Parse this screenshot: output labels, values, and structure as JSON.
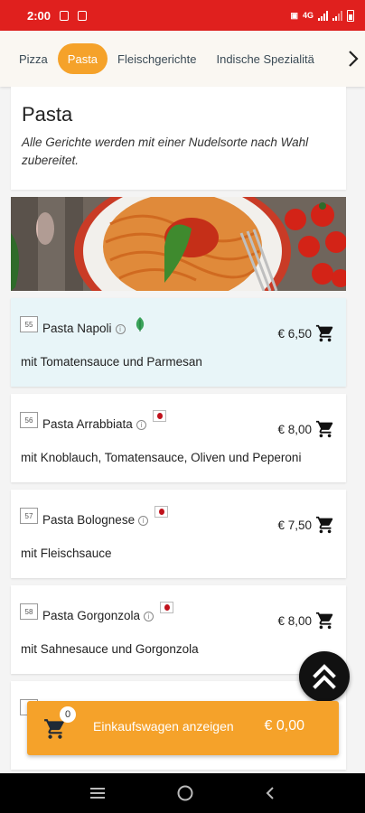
{
  "status_bar": {
    "time": "2:00",
    "network": "4G"
  },
  "tabs": [
    {
      "label": "Pizza"
    },
    {
      "label": "Pasta",
      "active": true
    },
    {
      "label": "Fleischgerichte"
    },
    {
      "label": "Indische Spezialitä"
    }
  ],
  "section": {
    "title": "Pasta",
    "description": "Alle Gerichte werden mit einer Nudelsorte nach Wahl zubereitet."
  },
  "items": [
    {
      "number": "55",
      "name": "Pasta Napoli",
      "price": "€ 6,50",
      "description": "mit Tomatensauce und Parmesan",
      "badge": "leaf-icon"
    },
    {
      "number": "56",
      "name": "Pasta Arrabbiata",
      "price": "€ 8,00",
      "description": "mit Knoblauch, Tomatensauce, Oliven und Peperoni",
      "badge": "pepper-icon"
    },
    {
      "number": "57",
      "name": "Pasta Bolognese",
      "price": "€ 7,50",
      "description": "mit Fleischsauce",
      "badge": "pepper-icon"
    },
    {
      "number": "58",
      "name": "Pasta Gorgonzola",
      "price": "€ 8,00",
      "description": "mit Sahnesauce und Gorgonzola",
      "badge": "pepper-icon"
    }
  ],
  "cart": {
    "count": "0",
    "label": "Einkaufswagen anzeigen",
    "total": "€ 0,00"
  },
  "colors": {
    "status_bar": "#e0201e",
    "accent": "#f5a22a",
    "highlight_row": "#e8f5f8"
  }
}
